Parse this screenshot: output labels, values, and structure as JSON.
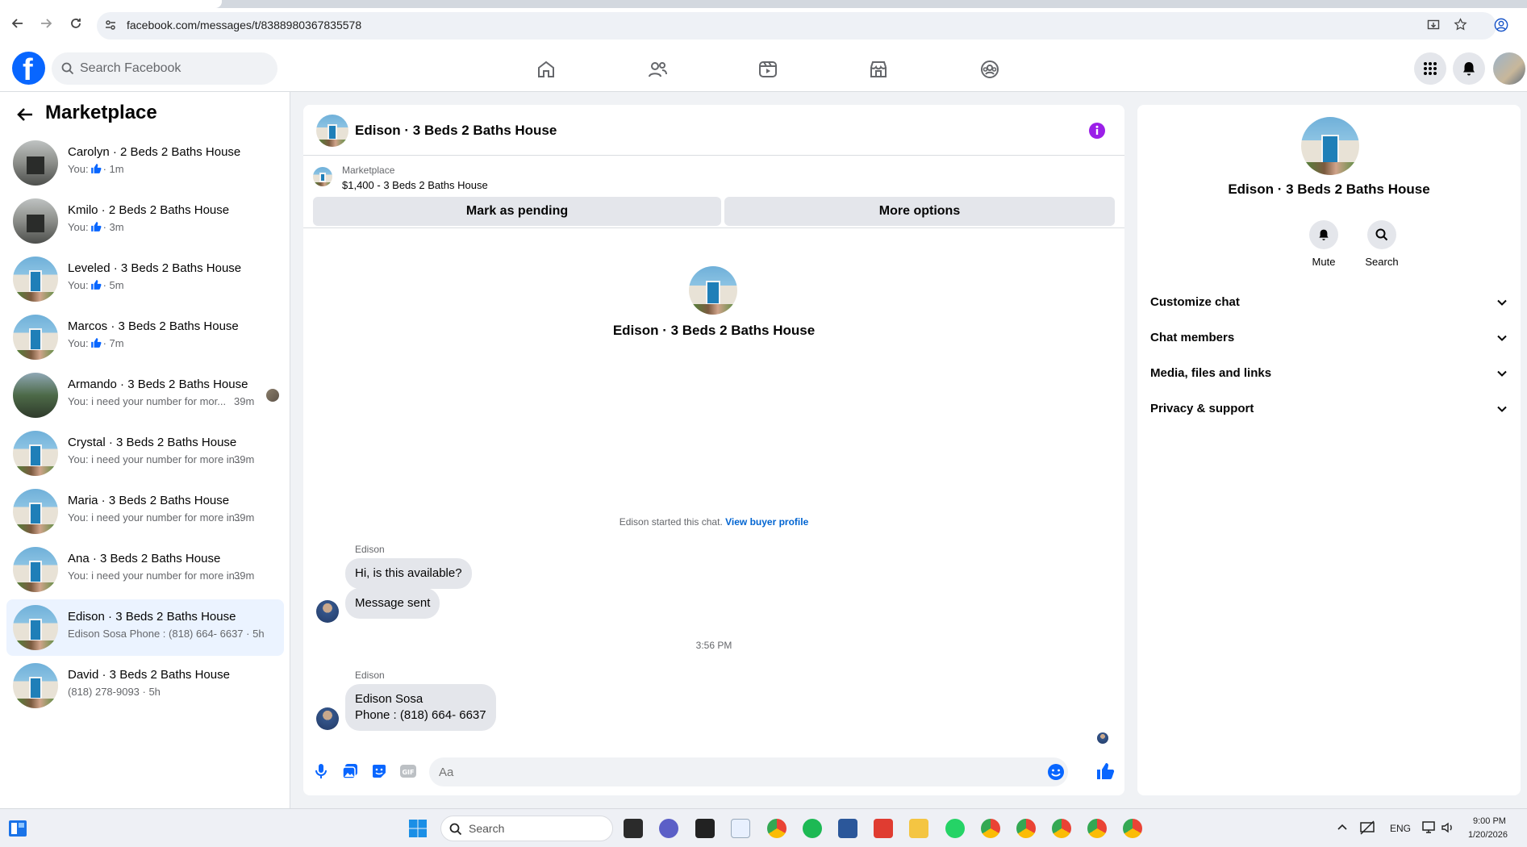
{
  "browser": {
    "url": "facebook.com/messages/t/8388980367835578"
  },
  "header": {
    "search_placeholder": "Search Facebook"
  },
  "left": {
    "title": "Marketplace",
    "conversations": [
      {
        "name": "Carolyn · 2 Beds 2 Baths House",
        "prefix": "You:",
        "suffix": "· 1m",
        "thumb": true,
        "time": "",
        "img": "gray"
      },
      {
        "name": "Kmilo · 2 Beds 2 Baths House",
        "prefix": "You:",
        "suffix": "· 3m",
        "thumb": true,
        "time": "",
        "img": "gray"
      },
      {
        "name": "Leveled · 3 Beds 2 Baths House",
        "prefix": "You:",
        "suffix": "· 5m",
        "thumb": true,
        "time": "",
        "img": "house"
      },
      {
        "name": "Marcos · 3 Beds 2 Baths House",
        "prefix": "You:",
        "suffix": "· 7m",
        "thumb": true,
        "time": "",
        "img": "house"
      },
      {
        "name": "Armando · 3 Beds 2 Baths House",
        "prefix": "You: i need your number for mor...",
        "suffix": "",
        "thumb": false,
        "time": "39m",
        "img": "tree"
      },
      {
        "name": "Crystal · 3 Beds 2 Baths House",
        "prefix": "You: i need your number for more in...",
        "suffix": "",
        "thumb": false,
        "time": "39m",
        "img": "house"
      },
      {
        "name": "Maria · 3 Beds 2 Baths House",
        "prefix": "You: i need your number for more in...",
        "suffix": "",
        "thumb": false,
        "time": "39m",
        "img": "house"
      },
      {
        "name": "Ana · 3 Beds 2 Baths House",
        "prefix": "You: i need your number for more in...",
        "suffix": "",
        "thumb": false,
        "time": "39m",
        "img": "house"
      },
      {
        "name": "Edison · 3 Beds 2 Baths House",
        "prefix": "Edison Sosa Phone : (818) 664- 6637 · 5h",
        "suffix": "",
        "thumb": false,
        "time": "",
        "img": "house"
      },
      {
        "name": "David · 3 Beds 2 Baths House",
        "prefix": "(818) 278-9093 · 5h",
        "suffix": "",
        "thumb": false,
        "time": "",
        "img": "house"
      }
    ]
  },
  "chat": {
    "title": "Edison · 3 Beds 2 Baths House",
    "listing_label": "Marketplace",
    "listing_price": "$1,400 - 3 Beds 2 Baths House",
    "mark_pending": "Mark as pending",
    "more_options": "More options",
    "intro_name": "Edison · 3 Beds 2 Baths House",
    "started_text": "Edison started this chat.",
    "view_profile": "View buyer profile",
    "sender1": "Edison",
    "msg1": "Hi, is this available?",
    "msg2": "Message sent",
    "time_sep": "3:56 PM",
    "sender2": "Edison",
    "msg3_line1": "Edison Sosa",
    "msg3_line2": "Phone : (818) 664- 6637",
    "input_placeholder": "Aa"
  },
  "right": {
    "name": "Edison · 3 Beds 2 Baths House",
    "mute": "Mute",
    "search": "Search",
    "sections": [
      "Customize chat",
      "Chat members",
      "Media, files and links",
      "Privacy & support"
    ]
  },
  "taskbar": {
    "search": "Search",
    "lang": "ENG",
    "time": "9:00 PM",
    "date": "1/20/2026"
  },
  "colors": {
    "brand": "#0866ff",
    "active_row": "#ebf3ff",
    "link": "#0064d1",
    "info_icon": "#9b1fe8"
  }
}
